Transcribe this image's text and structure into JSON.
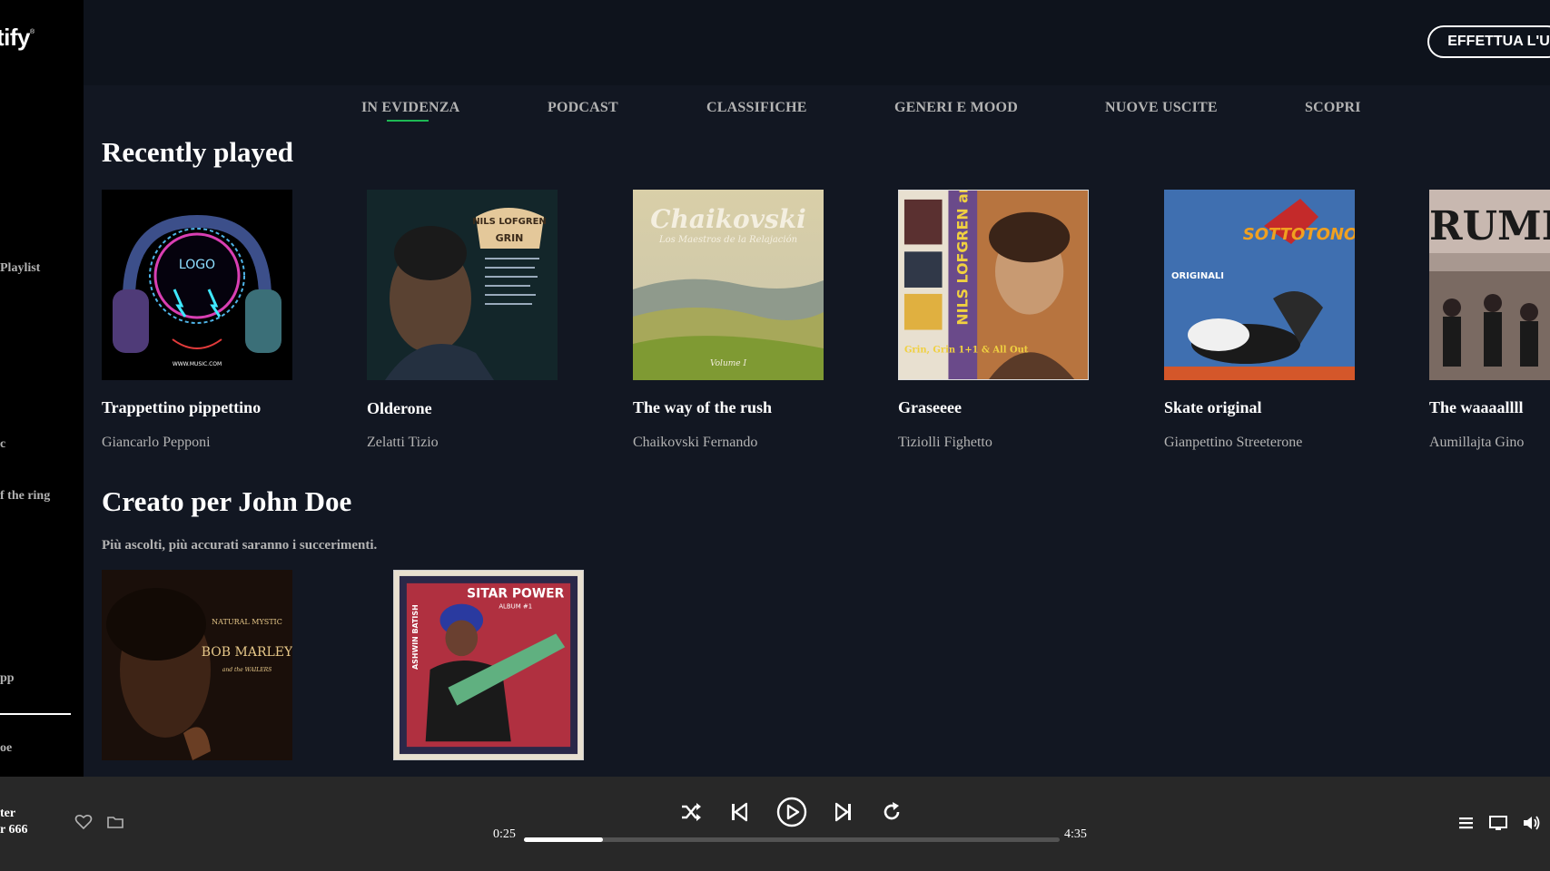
{
  "app": {
    "logo_text": "tify",
    "logo_mark": "®"
  },
  "sidebar": {
    "items": [
      {
        "label": "Playlist"
      },
      {
        "label": "c"
      },
      {
        "label": "f the ring"
      },
      {
        "label": "pp"
      },
      {
        "label": "oe"
      }
    ]
  },
  "header": {
    "login_label": "EFFETTUA L'U"
  },
  "tabs": [
    {
      "label": "IN EVIDENZA",
      "active": true
    },
    {
      "label": "PODCAST"
    },
    {
      "label": "CLASSIFICHE"
    },
    {
      "label": "GENERI E MOOD"
    },
    {
      "label": "NUOVE USCITE"
    },
    {
      "label": "SCOPRI"
    }
  ],
  "recently_played": {
    "title": "Recently played",
    "items": [
      {
        "title": "Trappettino pippettino",
        "artist": "Giancarlo Pepponi",
        "cover_text": "LOGO",
        "cover_sub": "WWW.MUSIC.COM"
      },
      {
        "title": "Olderone",
        "artist": "Zelatti Tizio",
        "cover_text": "NILS LOFGREN",
        "cover_sub": "GRIN"
      },
      {
        "title": "The way of the rush",
        "artist": "Chaikovski Fernando",
        "cover_text": "Chaikovski",
        "cover_sub": "Los Maestros de la Relajación",
        "cover_extra": "Volume I"
      },
      {
        "title": "Graseeee",
        "artist": "Tiziolli Fighetto",
        "cover_text": "NILS LOFGREN and GRIN",
        "cover_sub": "Grin, Grin 1+1 & All Out"
      },
      {
        "title": "Skate original",
        "artist": "Gianpettino Streeterone",
        "cover_text": "SOTTOTONO",
        "cover_sub": "ORIGINALI"
      },
      {
        "title": "The waaaallll",
        "artist": "Aumillajta Gino",
        "cover_text": "RUMILL"
      }
    ]
  },
  "made_for": {
    "title": "Creato per John Doe",
    "subtitle": "Più ascolti, più accurati saranno i succerimenti.",
    "items": [
      {
        "cover_text": "BOB MARLEY",
        "cover_sub": "NATURAL MYSTIC",
        "cover_extra": "and the WAILERS"
      },
      {
        "cover_text": "SITAR POWER",
        "cover_sub": "ALBUM #1",
        "cover_extra": "ASHWIN BATISH"
      }
    ]
  },
  "player": {
    "track_line1": "ter",
    "track_line2": "r 666",
    "elapsed": "0:25",
    "duration": "4:35",
    "progress": 0.148
  },
  "colors": {
    "accent": "#1db954",
    "main_bg": "#121722",
    "topbar_bg": "#0e131c",
    "player_bg": "#282828"
  }
}
